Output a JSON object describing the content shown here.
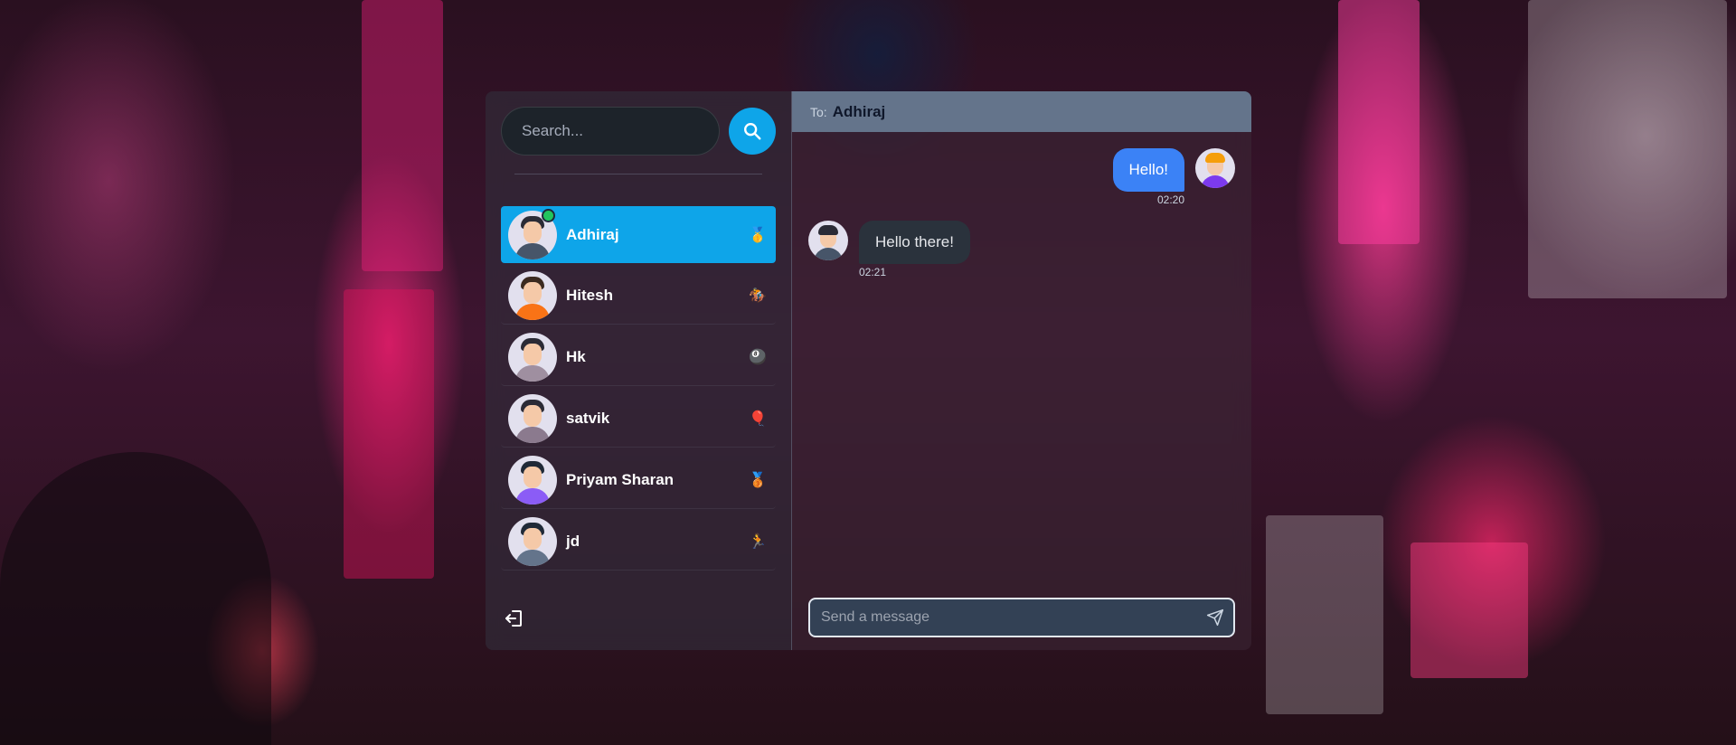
{
  "search": {
    "placeholder": "Search..."
  },
  "contacts": [
    {
      "name": "Adhiraj",
      "emoji": "🥇",
      "active": true,
      "online": true
    },
    {
      "name": "Hitesh",
      "emoji": "🏇",
      "active": false,
      "online": false
    },
    {
      "name": "Hk",
      "emoji": "🎱",
      "active": false,
      "online": false
    },
    {
      "name": "satvik",
      "emoji": "🎈",
      "active": false,
      "online": false
    },
    {
      "name": "Priyam Sharan",
      "emoji": "🥉",
      "active": false,
      "online": false
    },
    {
      "name": "jd",
      "emoji": "🏃",
      "active": false,
      "online": false
    }
  ],
  "chat": {
    "to_label": "To:",
    "to_name": "Adhiraj",
    "messages": [
      {
        "direction": "out",
        "text": "Hello!",
        "time": "02:20"
      },
      {
        "direction": "in",
        "text": "Hello there!",
        "time": "02:21"
      }
    ],
    "composer_placeholder": "Send a message"
  },
  "colors": {
    "accent": "#0ea5e9",
    "outgoing_bubble": "#3b82f6",
    "incoming_bubble": "#2a323c",
    "header": "#64748b"
  },
  "icons": {
    "search": "search-icon",
    "send": "send-icon",
    "logout": "logout-icon"
  }
}
